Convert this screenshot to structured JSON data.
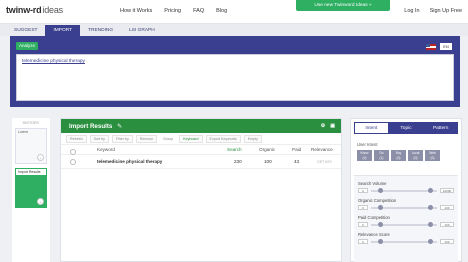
{
  "header": {
    "logo_main": "twinw-rd",
    "logo_sub": "ideas",
    "nav": [
      "How it Works",
      "Pricing",
      "FAQ",
      "Blog"
    ],
    "cta": "Use new Twinword Ideas »",
    "login": "Log In",
    "signup": "Sign Up Free"
  },
  "tabs": [
    "SUGGEST",
    "IMPORT",
    "TRENDING",
    "LSI GRAPH"
  ],
  "active_tab": "IMPORT",
  "input_panel": {
    "analyze": "Analyze",
    "lang": "EN",
    "text": "telemedicine physical therapy"
  },
  "sidebar": {
    "heading": "HISTORY",
    "items": [
      "Lorem",
      "Import Results"
    ],
    "badge": "+"
  },
  "results": {
    "title": "Import Results",
    "edit_icon": "✎",
    "toolbar": [
      "Refresh",
      "Sort by",
      "Filter by",
      "Remove",
      "Group",
      "Keyboard",
      "Export Keywords",
      "Empty"
    ],
    "columns": [
      "Keyword",
      "Search",
      "Organic",
      "Paid",
      "Relevance"
    ],
    "rows": [
      {
        "keyword": "telemedicine physical therapy",
        "search": "230",
        "organic": "100",
        "paid": "43",
        "relevance": "GET KEY"
      }
    ]
  },
  "right_panel": {
    "tabs": [
      "Intent",
      "Topic",
      "Pattern"
    ],
    "user_intent_label": "User Intent",
    "intents": [
      {
        "top": "Know",
        "sub": "(0)"
      },
      {
        "top": "Do",
        "sub": "(1)"
      },
      {
        "top": "Buy",
        "sub": "(0)"
      },
      {
        "top": "Local",
        "sub": "(0)"
      },
      {
        "top": "Web",
        "sub": "(0)"
      }
    ],
    "filters": [
      {
        "label": "Search Volume",
        "min": "0",
        "max": "10000"
      },
      {
        "label": "Organic Competition",
        "min": "0",
        "max": "100"
      },
      {
        "label": "Paid Competition",
        "min": "0",
        "max": "100"
      },
      {
        "label": "Relevance Score",
        "min": "0",
        "max": "100"
      }
    ]
  },
  "colors": {
    "brand_blue": "#3b3f8f",
    "green": "#2eaf62",
    "dark_green": "#2a8f3f"
  }
}
